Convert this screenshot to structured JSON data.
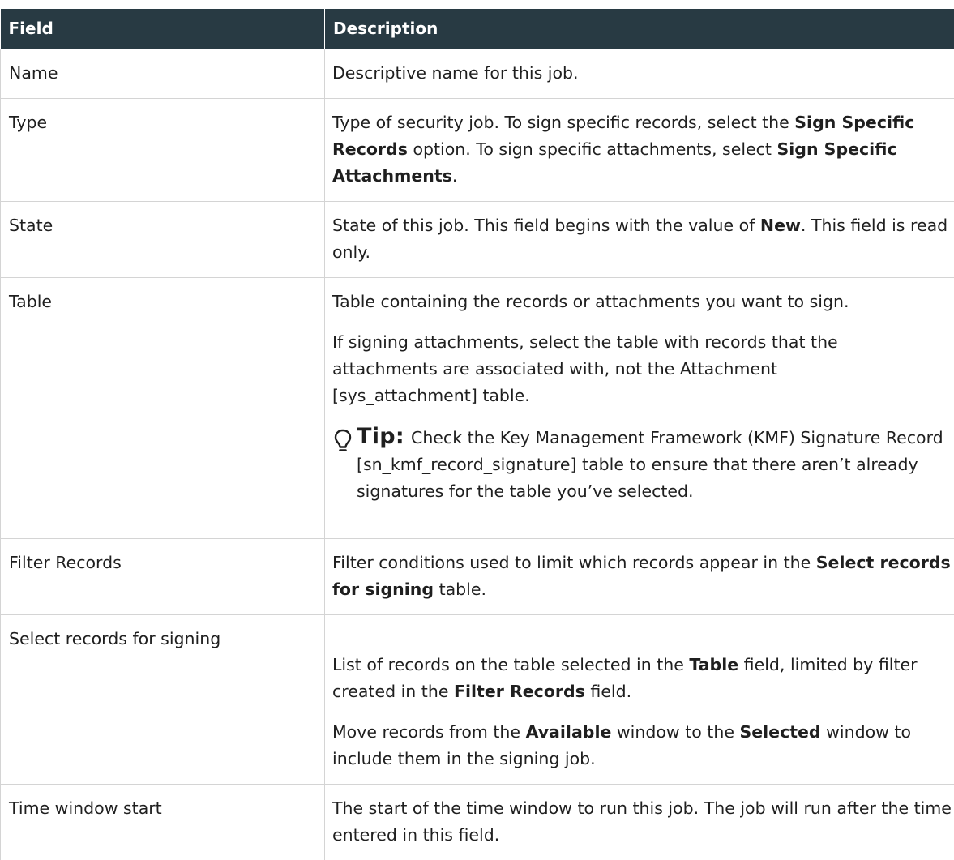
{
  "table": {
    "headers": {
      "field": "Field",
      "description": "Description"
    },
    "rows": {
      "name": {
        "field": "Name",
        "desc": "Descriptive name for this job."
      },
      "type": {
        "field": "Type",
        "desc_1": "Type of security job. To sign specific records, select the ",
        "desc_2": "Sign Specific Records",
        "desc_3": " option. To sign specific attachments, select ",
        "desc_4": "Sign Specific Attachments",
        "desc_5": "."
      },
      "state": {
        "field": "State",
        "desc_1": "State of this job. This field begins with the value of ",
        "desc_2": "New",
        "desc_3": ". This field is read only."
      },
      "table": {
        "field": "Table",
        "para_1": "Table containing the records or attachments you want to sign.",
        "para_2": "If signing attachments, select the table with records that the attachments are associated with, not the Attachment [sys_attachment] table.",
        "tip_label": "Tip:",
        "tip_text": "Check the Key Management Framework (KMF) Signature Record [sn_kmf_record_signature] table to ensure that there aren’t already signatures for the table you’ve selected."
      },
      "filter": {
        "field": "Filter Records",
        "desc_1": "Filter conditions used to limit which records appear in the ",
        "desc_2": "Select records for signing",
        "desc_3": " table."
      },
      "select": {
        "field": "Select records for signing",
        "p1_1": "List of records on the table selected in the ",
        "p1_2": "Table",
        "p1_3": " field, limited by filter created in the ",
        "p1_4": "Filter Records",
        "p1_5": " field.",
        "p2_1": "Move records from the ",
        "p2_2": "Available",
        "p2_3": " window to the ",
        "p2_4": "Selected",
        "p2_5": " window to include them in the signing job."
      },
      "time_start": {
        "field": "Time window start",
        "desc": "The start of the time window to run this job. The job will run after the time entered in this field."
      }
    }
  },
  "icons": {
    "tip": "lightbulb-icon"
  }
}
